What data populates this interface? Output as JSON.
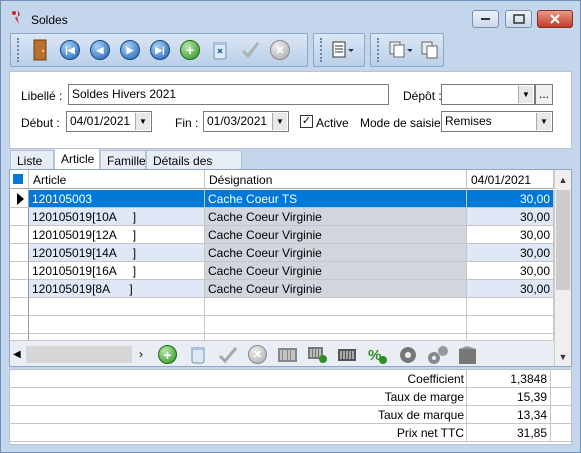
{
  "window": {
    "title": "Soldes"
  },
  "form": {
    "libelle_label": "Libellé :",
    "libelle_value": "Soldes Hivers 2021",
    "depot_label": "Dépôt :",
    "depot_value": "",
    "depot_more": "...",
    "debut_label": "Début :",
    "debut_value": "04/01/2021",
    "fin_label": "Fin :",
    "fin_value": "01/03/2021",
    "active_label": "Active",
    "active_checked": true,
    "mode_label": "Mode de saisie :",
    "mode_value": "Remises"
  },
  "tabs": [
    "Liste",
    "Article",
    "Familles",
    "Détails des ventes"
  ],
  "active_tab": "Article",
  "grid": {
    "columns": [
      "Article",
      "Désignation",
      "04/01/2021"
    ],
    "rows": [
      {
        "article": "120105003",
        "designation": "Cache Coeur TS",
        "value": "30,00",
        "selected": true
      },
      {
        "article": "120105019[10A     ]",
        "designation": "Cache Coeur Virginie",
        "value": "30,00"
      },
      {
        "article": "120105019[12A     ]",
        "designation": "Cache Coeur Virginie",
        "value": "30,00"
      },
      {
        "article": "120105019[14A     ]",
        "designation": "Cache Coeur Virginie",
        "value": "30,00"
      },
      {
        "article": "120105019[16A     ]",
        "designation": "Cache Coeur Virginie",
        "value": "30,00"
      },
      {
        "article": "120105019[8A      ]",
        "designation": "Cache Coeur Virginie",
        "value": "30,00"
      }
    ]
  },
  "stats": [
    {
      "label": "Coefficient",
      "value": "1,3848"
    },
    {
      "label": "Taux de marge",
      "value": "15,39"
    },
    {
      "label": "Taux de marque",
      "value": "13,34"
    },
    {
      "label": "Prix net TTC",
      "value": "31,85"
    }
  ],
  "colors": {
    "selected_row": "#0078d7",
    "designation_bg": "#d1d5de",
    "alt_row": "#dfe8f6"
  }
}
